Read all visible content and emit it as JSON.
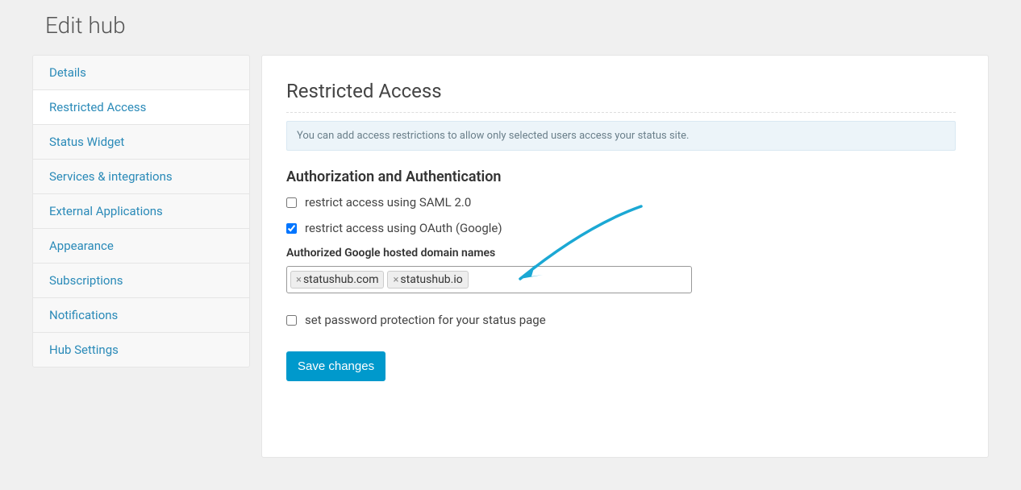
{
  "page_title": "Edit hub",
  "sidebar": {
    "items": [
      {
        "label": "Details",
        "active": false
      },
      {
        "label": "Restricted Access",
        "active": true
      },
      {
        "label": "Status Widget",
        "active": false
      },
      {
        "label": "Services & integrations",
        "active": false
      },
      {
        "label": "External Applications",
        "active": false
      },
      {
        "label": "Appearance",
        "active": false
      },
      {
        "label": "Subscriptions",
        "active": false
      },
      {
        "label": "Notifications",
        "active": false
      },
      {
        "label": "Hub Settings",
        "active": false
      }
    ]
  },
  "main": {
    "section_title": "Restricted Access",
    "info_text": "You can add access restrictions to allow only selected users access your status site.",
    "auth_heading": "Authorization and Authentication",
    "checkboxes": {
      "saml": {
        "label": "restrict access using SAML 2.0",
        "checked": false
      },
      "oauth": {
        "label": "restrict access using OAuth (Google)",
        "checked": true
      },
      "password": {
        "label": "set password protection for your status page",
        "checked": false
      }
    },
    "domain_field_label": "Authorized Google hosted domain names",
    "domain_tags": [
      "statushub.com",
      "statushub.io"
    ],
    "save_button": "Save changes"
  },
  "colors": {
    "accent": "#0099cc",
    "link": "#2a8ab8",
    "info_bg": "#ecf4f9"
  }
}
